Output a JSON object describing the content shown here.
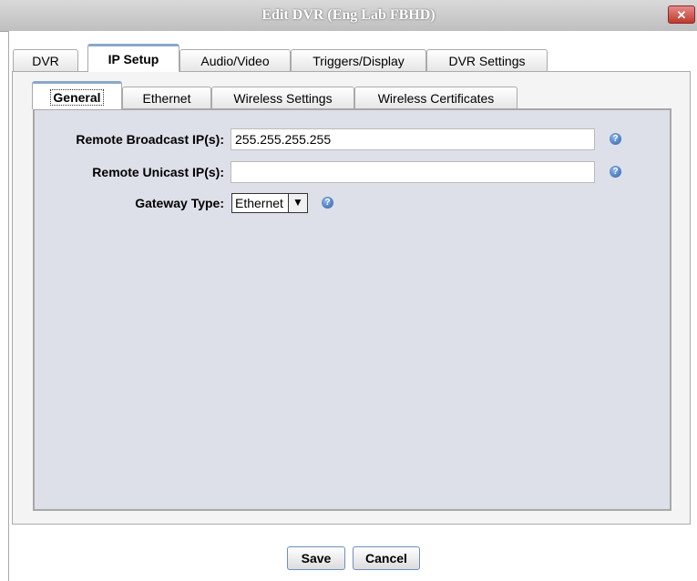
{
  "window": {
    "title": "Edit DVR (Eng Lab FBHD)",
    "close_glyph": "✕"
  },
  "outer_tabs": [
    "DVR",
    "IP Setup",
    "Audio/Video",
    "Triggers/Display",
    "DVR Settings"
  ],
  "inner_tabs": [
    "General",
    "Ethernet",
    "Wireless Settings",
    "Wireless Certificates"
  ],
  "form": {
    "remote_broadcast_label": "Remote Broadcast IP(s):",
    "remote_broadcast_value": "255.255.255.255",
    "remote_unicast_label": "Remote Unicast IP(s):",
    "remote_unicast_value": "",
    "gateway_type_label": "Gateway Type:",
    "gateway_type_value": "Ethernet",
    "help_glyph": "?"
  },
  "buttons": {
    "save": "Save",
    "cancel": "Cancel"
  },
  "icons": {
    "close": "close-icon",
    "help": "help-icon",
    "dropdown": "chevron-down-icon"
  }
}
